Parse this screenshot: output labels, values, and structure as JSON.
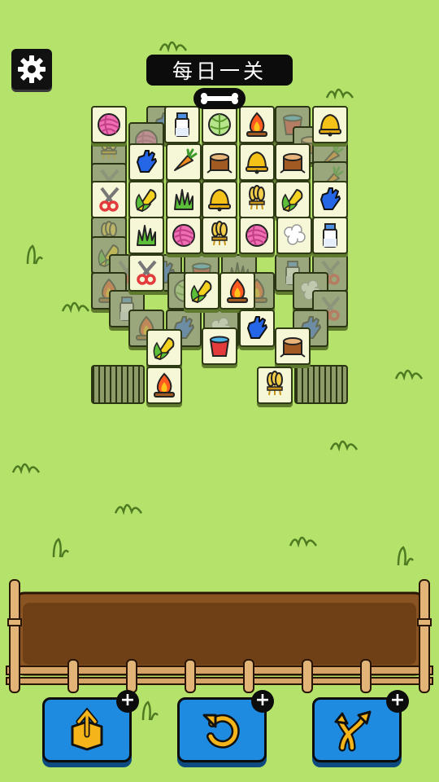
{
  "header": {
    "title": "每日一关",
    "settings_icon": "gear-icon",
    "progress_icon": "bone-icon"
  },
  "board": {
    "tile_types": [
      "yarn",
      "glove",
      "milk",
      "cabbage",
      "campfire",
      "bucket",
      "bell",
      "stump",
      "carrot",
      "shears",
      "corn",
      "grass",
      "wheat",
      "wool"
    ]
  },
  "tray": {
    "slots_filled": 0
  },
  "tools": [
    {
      "name": "move-out",
      "icon": "box-out-icon",
      "plus": "+"
    },
    {
      "name": "undo",
      "icon": "undo-icon",
      "plus": "+"
    },
    {
      "name": "shuffle",
      "icon": "shuffle-icon",
      "plus": "+"
    }
  ],
  "colors": {
    "background": "#b4e26b",
    "button": "#1e8ae0",
    "tile": "#f6f7d6"
  }
}
